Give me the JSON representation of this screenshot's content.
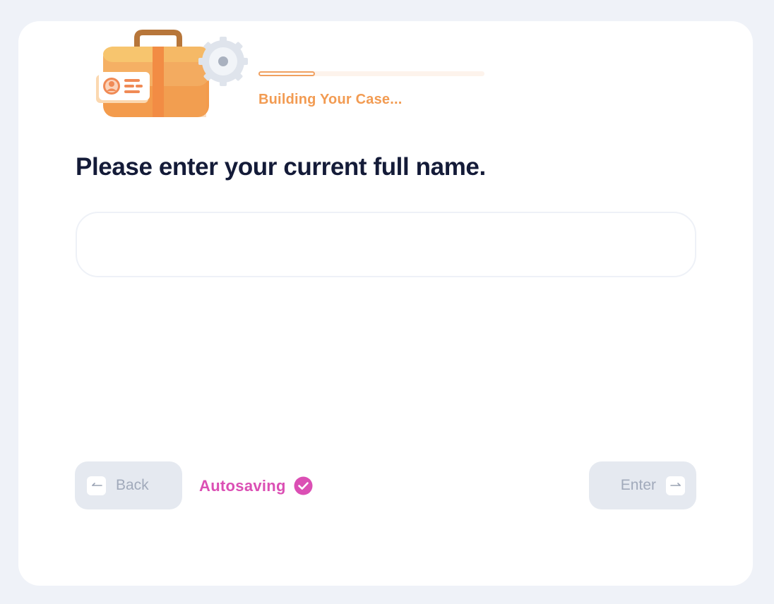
{
  "progress": {
    "label": "Building Your Case...",
    "fraction": 0.25
  },
  "question": {
    "text": "Please enter your current full name."
  },
  "name_input": {
    "value": "",
    "placeholder": ""
  },
  "footer": {
    "back_label": "Back",
    "enter_label": "Enter",
    "autosave_label": "Autosaving"
  },
  "icons": {
    "illustration": "briefcase-gear-icon",
    "back": "arrow-left-icon",
    "enter": "arrow-right-icon",
    "autosave": "check-circle-icon"
  },
  "colors": {
    "background": "#eff2f8",
    "card": "#ffffff",
    "accent_orange": "#f29b52",
    "heading": "#141b38",
    "autosave_pink": "#db4fb4",
    "button_bg": "#e5e9f0",
    "button_text": "#a1aabb"
  }
}
